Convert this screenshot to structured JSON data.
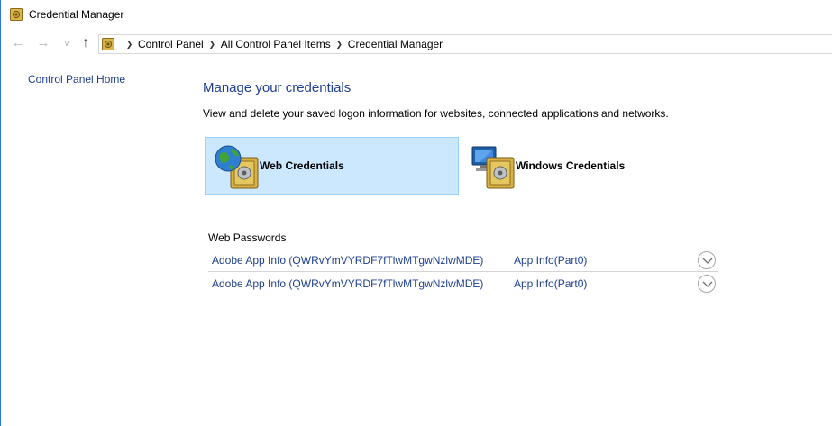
{
  "window": {
    "title": "Credential Manager"
  },
  "nav": {
    "back_icon": "arrow-left-icon",
    "forward_icon": "arrow-right-icon",
    "recent_icon": "chevron-down-icon",
    "up_icon": "arrow-up-icon"
  },
  "breadcrumb": {
    "items": [
      "Control Panel",
      "All Control Panel Items",
      "Credential Manager"
    ]
  },
  "leftnav": {
    "home_label": "Control Panel Home"
  },
  "main": {
    "title": "Manage your credentials",
    "description": "View and delete your saved logon information for websites, connected applications and networks.",
    "tiles": [
      {
        "label": "Web Credentials",
        "icon": "globe-vault-icon",
        "selected": true
      },
      {
        "label": "Windows Credentials",
        "icon": "monitor-vault-icon",
        "selected": false
      }
    ]
  },
  "web_passwords": {
    "section_title": "Web Passwords",
    "rows": [
      {
        "name": "Adobe App Info (QWRvYmVYRDF7fTlwMTgwNzlwMDE)",
        "user": "App Info(Part0)"
      },
      {
        "name": "Adobe App Info (QWRvYmVYRDF7fTlwMTgwNzlwMDE)",
        "user": "App Info(Part0)"
      }
    ]
  },
  "colors": {
    "link": "#1e3f90",
    "tile_selected_bg": "#cce8ff",
    "tile_selected_border": "#99d1ff",
    "window_border": "#2b79d6",
    "divider": "#d4d4d4"
  }
}
